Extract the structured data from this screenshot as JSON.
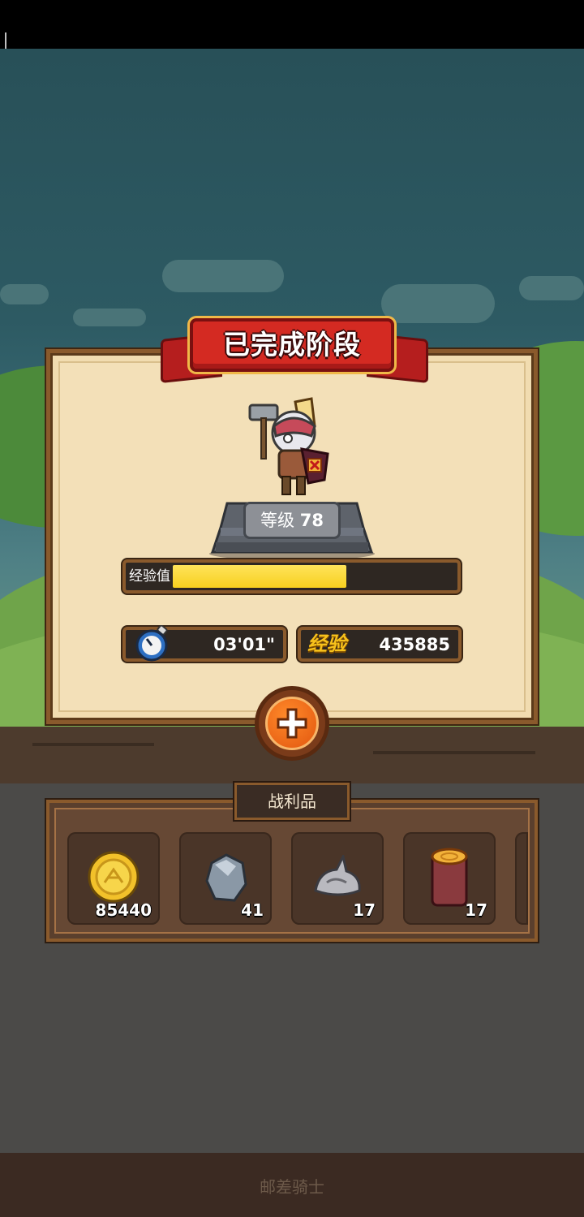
{
  "banner": {
    "title": "已完成阶段"
  },
  "hero": {
    "level_label": "等级",
    "level_value": "78"
  },
  "xp": {
    "label": "经验值",
    "fill_fraction": 0.62
  },
  "stats": {
    "time": "03'01\"",
    "exp_label": "经验",
    "exp_value": "435885"
  },
  "loot": {
    "title": "战利品",
    "items": [
      {
        "icon": "gold-coin-icon",
        "count": "85440"
      },
      {
        "icon": "stone-icon",
        "count": "41"
      },
      {
        "icon": "iron-ore-icon",
        "count": "17"
      },
      {
        "icon": "wood-log-icon",
        "count": "17"
      }
    ]
  },
  "footer": {
    "text": "邮差骑士"
  },
  "colors": {
    "accent_red": "#d42a22",
    "xp_yellow": "#f7d01f",
    "panel_beige": "#f1dcb0",
    "frame_brown": "#8a5a2c"
  }
}
